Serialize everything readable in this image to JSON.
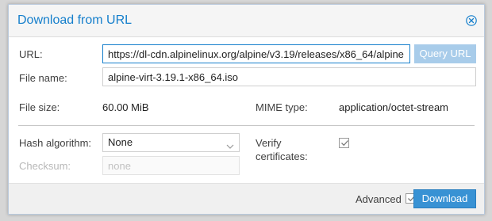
{
  "dialog": {
    "title": "Download from URL"
  },
  "form": {
    "url_label": "URL:",
    "url_value": "https://dl-cdn.alpinelinux.org/alpine/v3.19/releases/x86_64/alpine",
    "query_button": "Query URL",
    "filename_label": "File name:",
    "filename_value": "alpine-virt-3.19.1-x86_64.iso",
    "filesize_label": "File size:",
    "filesize_value": "60.00 MiB",
    "mime_label": "MIME type:",
    "mime_value": "application/octet-stream",
    "hash_label": "Hash algorithm:",
    "hash_value": "None",
    "checksum_label": "Checksum:",
    "checksum_placeholder": "none",
    "verify_label_line1": "Verify",
    "verify_label_line2": "certificates:",
    "verify_checked": true
  },
  "footer": {
    "advanced_label": "Advanced",
    "advanced_checked": true,
    "download_button": "Download"
  },
  "colors": {
    "accent": "#157fcc",
    "primary_button": "#3892d4",
    "disabled_button": "#a8ccea"
  },
  "icons": {
    "close": "close-circle-icon",
    "dropdown": "chevron-down-icon",
    "check": "checkmark-icon"
  }
}
